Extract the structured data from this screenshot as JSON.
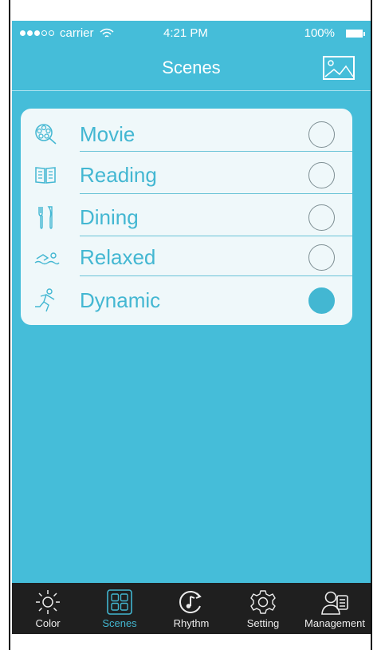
{
  "status_bar": {
    "carrier": "carrier",
    "time": "4:21 PM",
    "battery": "100%",
    "signal_dots_filled": 3,
    "signal_dots_total": 5,
    "wifi_icon": "wifi-icon",
    "battery_icon": "battery-icon"
  },
  "nav": {
    "title": "Scenes",
    "action_icon": "image-icon"
  },
  "scenes": [
    {
      "label": "Movie",
      "icon": "film-reel-icon",
      "selected": false
    },
    {
      "label": "Reading",
      "icon": "book-icon",
      "selected": false
    },
    {
      "label": "Dining",
      "icon": "fork-knife-icon",
      "selected": false
    },
    {
      "label": "Relaxed",
      "icon": "swimmer-icon",
      "selected": false
    },
    {
      "label": "Dynamic",
      "icon": "runner-icon",
      "selected": true
    }
  ],
  "tabs": [
    {
      "label": "Color",
      "icon": "sun-icon",
      "active": false
    },
    {
      "label": "Scenes",
      "icon": "scenes-grid-icon",
      "active": true
    },
    {
      "label": "Rhythm",
      "icon": "music-rhythm-icon",
      "active": false
    },
    {
      "label": "Setting",
      "icon": "gear-icon",
      "active": false
    },
    {
      "label": "Management",
      "icon": "user-management-icon",
      "active": false
    }
  ],
  "colors": {
    "background": "#45bdd9",
    "accent": "#43b7d2",
    "card_background": "#eff8fa",
    "tab_bar_background": "#1f1f1f",
    "radio_border": "#7d8e93"
  }
}
